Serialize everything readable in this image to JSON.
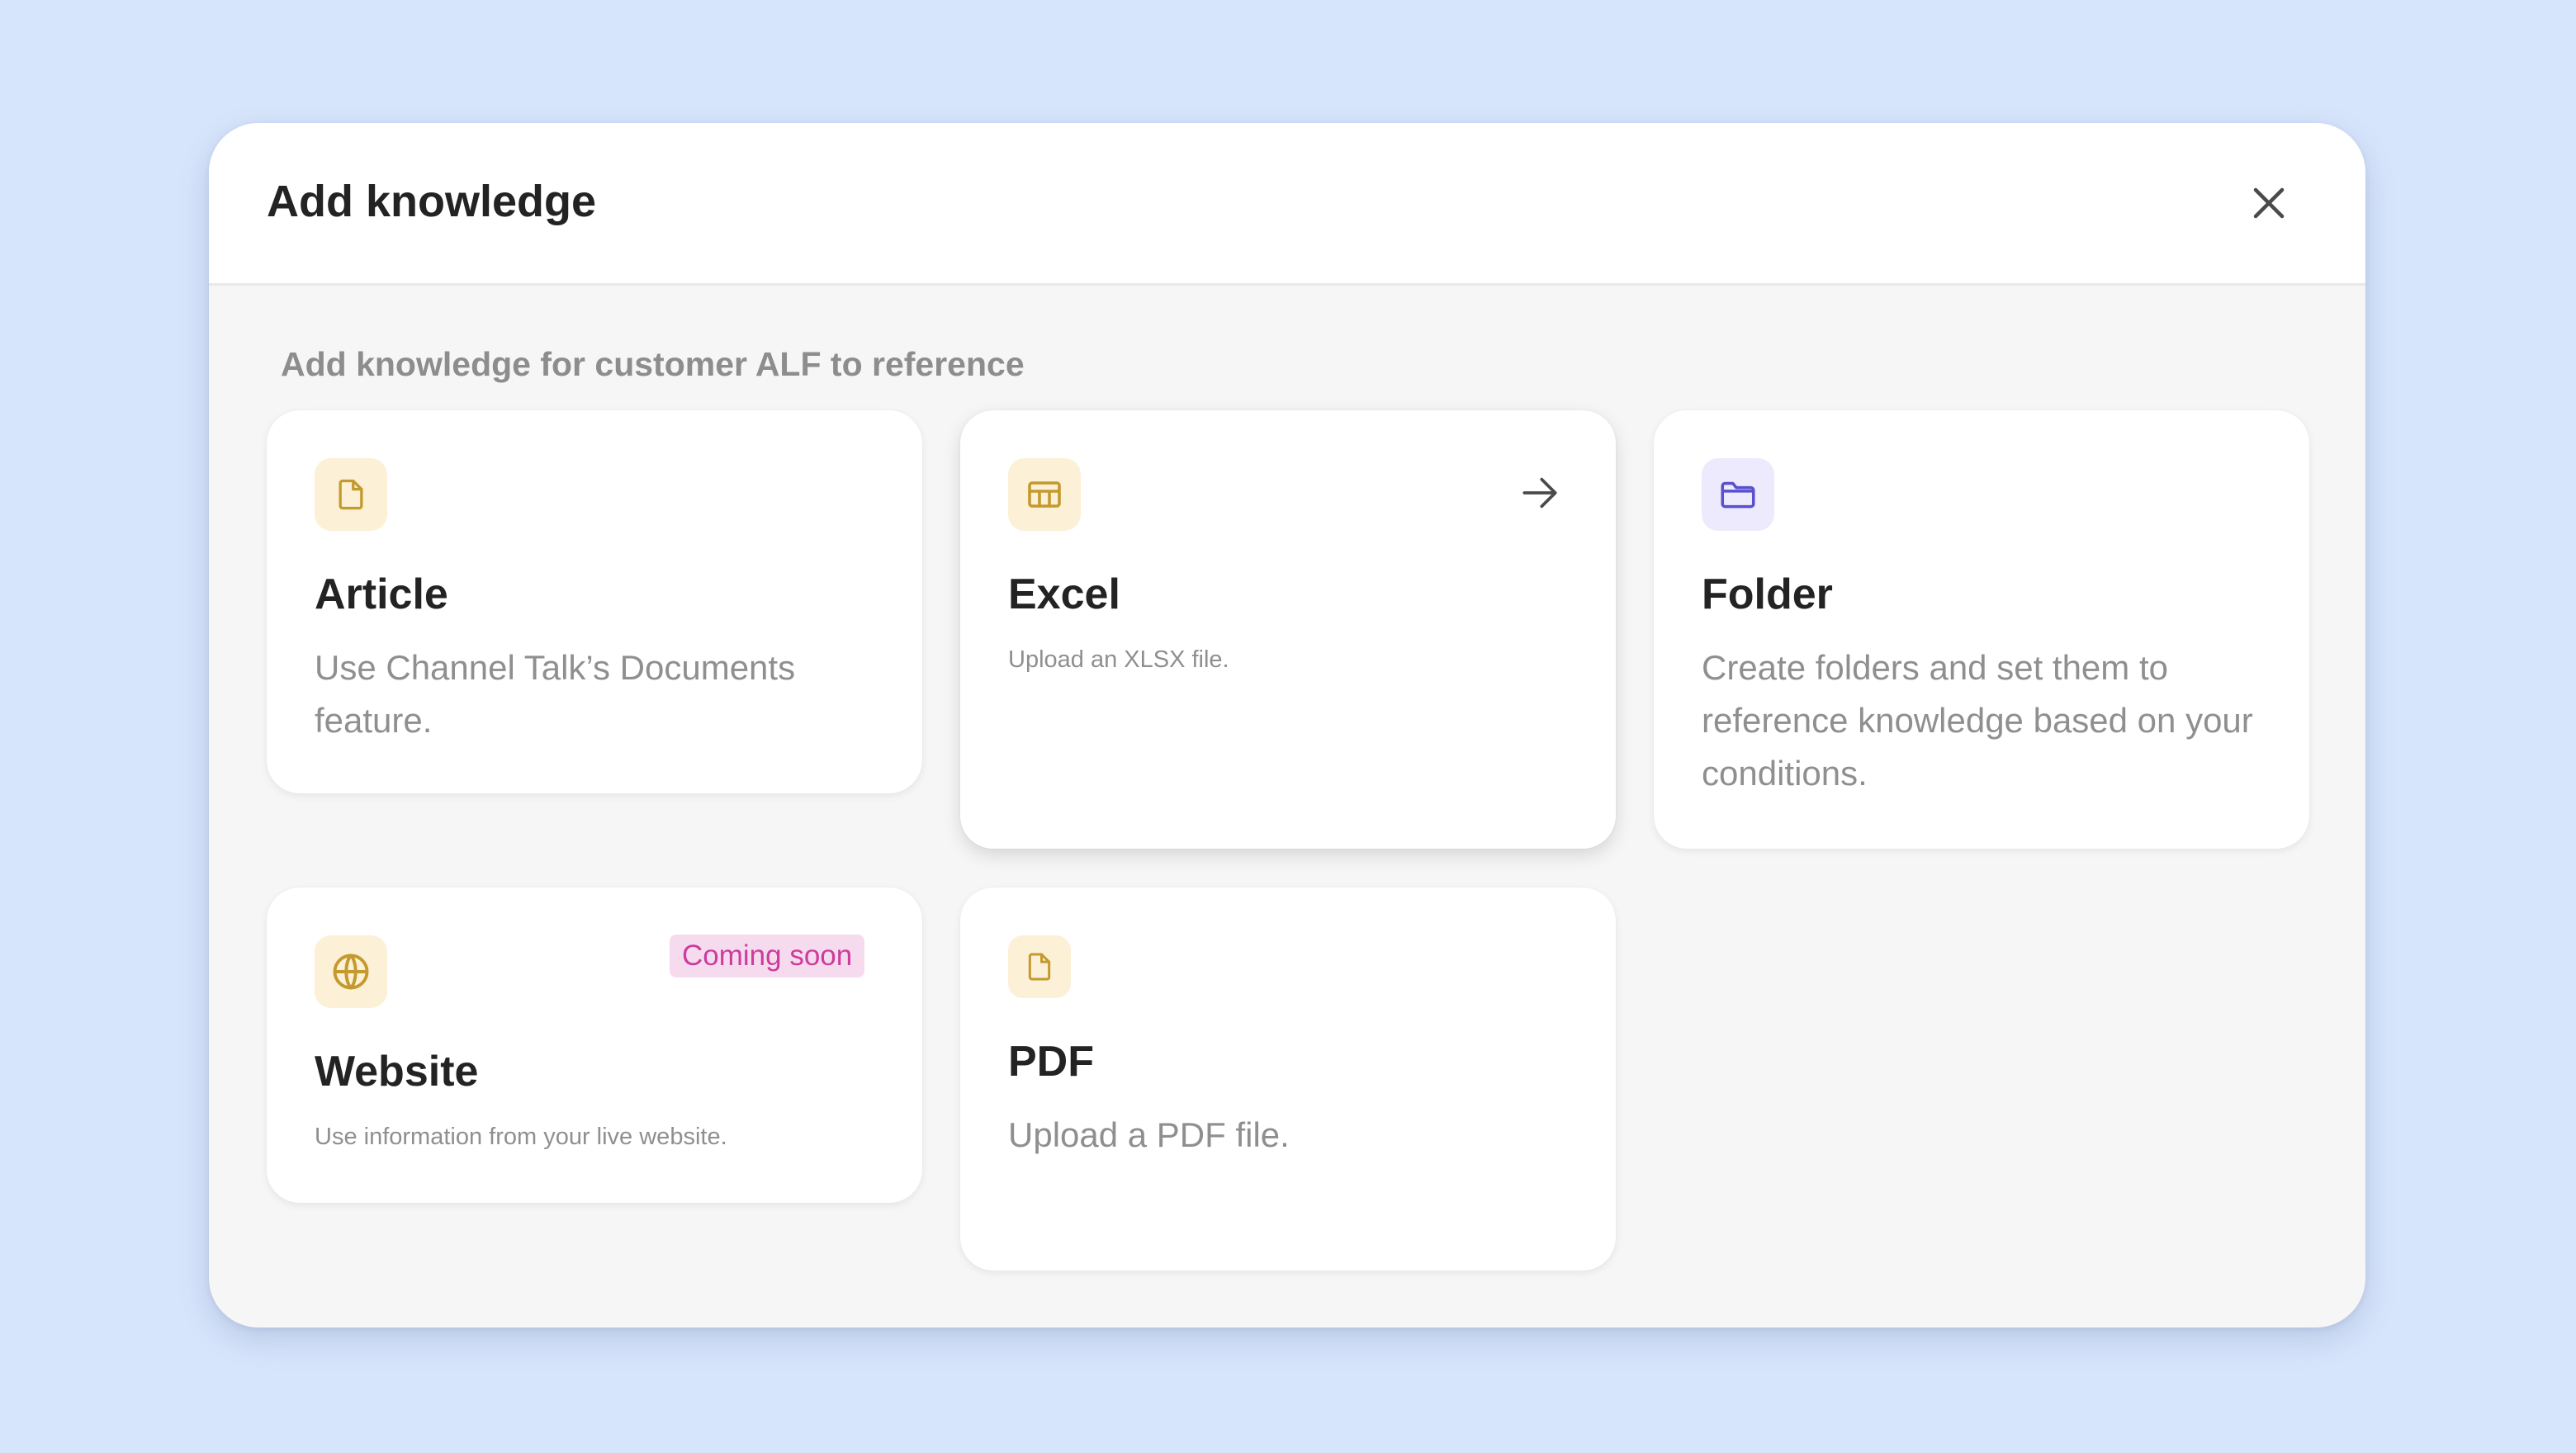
{
  "modal": {
    "title": "Add knowledge",
    "subtitle": "Add knowledge for customer ALF to reference"
  },
  "colors": {
    "page_background": "#d7e5fc",
    "icon_bg_yellow": "#fcf0d6",
    "icon_yellow": "#c49a2e",
    "icon_bg_purple": "#eceafc",
    "icon_purple": "#5a4fcf",
    "badge_bg": "#f6dbee",
    "badge_text": "#cc3c9c"
  },
  "cards": {
    "article": {
      "icon": "document-icon",
      "title": "Article",
      "description": "Use Channel Talk’s Documents feature."
    },
    "excel": {
      "icon": "table-icon",
      "title": "Excel",
      "description": "Upload an XLSX file."
    },
    "folder": {
      "icon": "folder-icon",
      "title": "Folder",
      "description": "Create folders and set them to reference knowledge based on your conditions."
    },
    "website": {
      "icon": "globe-icon",
      "title": "Website",
      "description": "Use information from your live website.",
      "badge": "Coming soon"
    },
    "pdf": {
      "icon": "document-icon",
      "title": "PDF",
      "description": "Upload a PDF file."
    }
  }
}
